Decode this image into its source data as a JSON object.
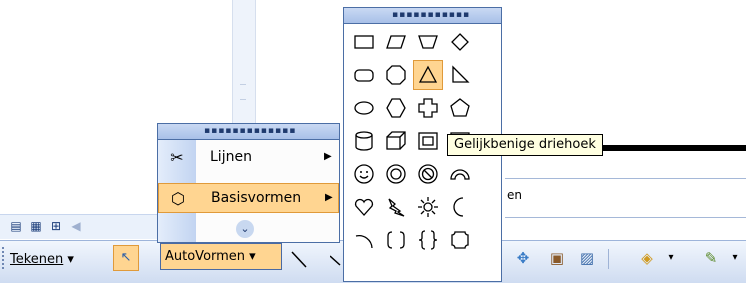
{
  "toolbar": {
    "tekenen_label": "Tekenen",
    "autovormen_label": "AutoVormen"
  },
  "menu": {
    "items": [
      {
        "label": "Lijnen",
        "icon": "lines-icon"
      },
      {
        "label": "Basisvormen",
        "icon": "basic-shapes-icon"
      }
    ]
  },
  "palette": {
    "shapes": [
      [
        "rectangle",
        "parallelogram",
        "trapezoid",
        "diamond"
      ],
      [
        "rounded-rectangle",
        "octagon",
        "isosceles-triangle",
        "right-triangle"
      ],
      [
        "oval",
        "hexagon",
        "cross",
        "pentagon"
      ],
      [
        "can",
        "cube",
        "bevel",
        "frame"
      ],
      [
        "smiley-face",
        "donut",
        "no-symbol",
        "block-arc"
      ],
      [
        "heart",
        "lightning-bolt",
        "sun",
        "moon"
      ],
      [
        "arc",
        "double-bracket",
        "double-brace",
        "plaque"
      ]
    ]
  },
  "tooltip": "Gelijkbenige driehoek",
  "background_text": "en",
  "colors": {
    "highlight": "#ffd591",
    "border": "#4b6ea5"
  }
}
